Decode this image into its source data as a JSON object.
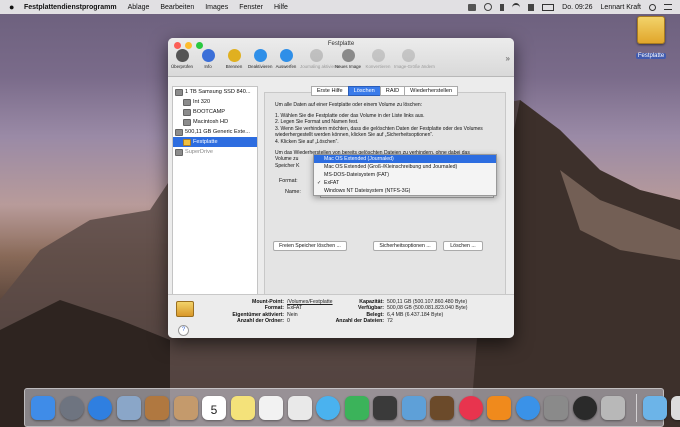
{
  "menubar": {
    "app_name": "Festplattendienstprogramm",
    "menus": [
      "Ablage",
      "Bearbeiten",
      "Images",
      "Fenster",
      "Hilfe"
    ],
    "clock": "Do. 09:26",
    "user": "Lennart Kraft"
  },
  "desktop": {
    "drive_label": "Festplatte"
  },
  "window": {
    "title": "Festplatte",
    "toolbar": [
      {
        "label": "Überprüfen",
        "icon": "microscope-icon",
        "color": "#555555",
        "enabled": true
      },
      {
        "label": "Info",
        "icon": "info-icon",
        "color": "#3b6fd8",
        "enabled": true
      },
      {
        "label": "Brennen",
        "icon": "burn-icon",
        "color": "#e0b020",
        "enabled": true
      },
      {
        "label": "Deaktivieren",
        "icon": "eject-icon",
        "color": "#2f8fe8",
        "enabled": true
      },
      {
        "label": "Auswerfen",
        "icon": "eject-icon",
        "color": "#2f8fe8",
        "enabled": true
      },
      {
        "label": "Journaling aktivieren",
        "icon": "journal-icon",
        "color": "#7a7a7a",
        "enabled": false
      },
      {
        "label": "Neues Image",
        "icon": "new-image-icon",
        "color": "#8a8a8a",
        "enabled": true
      },
      {
        "label": "Konvertieren",
        "icon": "convert-icon",
        "color": "#8a8a8a",
        "enabled": false
      },
      {
        "label": "Image-Größe ändern",
        "icon": "resize-icon",
        "color": "#8a8a8a",
        "enabled": false
      }
    ],
    "more": "»"
  },
  "sidebar": {
    "items": [
      {
        "label": "1 TB Samsung SSD 840...",
        "indent": 0,
        "selected": false,
        "dim": false
      },
      {
        "label": "Int 320",
        "indent": 1,
        "selected": false,
        "dim": false
      },
      {
        "label": "BOOTCAMP",
        "indent": 1,
        "selected": false,
        "dim": false
      },
      {
        "label": "Macintosh HD",
        "indent": 1,
        "selected": false,
        "dim": false
      },
      {
        "label": "500,11 GB Generic Exte...",
        "indent": 0,
        "selected": false,
        "dim": false
      },
      {
        "label": "Festplatte",
        "indent": 1,
        "selected": true,
        "dim": false
      },
      {
        "label": "SuperDrive",
        "indent": 0,
        "selected": false,
        "dim": true
      }
    ]
  },
  "tabs": [
    "Erste Hilfe",
    "Löschen",
    "RAID",
    "Wiederherstellen"
  ],
  "active_tab": "Löschen",
  "instructions": {
    "intro": "Um alle Daten auf einer Festplatte oder einem Volume zu löschen:",
    "steps": [
      "1.   Wählen Sie die Festplatte oder das Volume in der Liste links aus.",
      "2.   Legen Sie Format und Namen fest.",
      "3.   Wenn Sie verhindern möchten, dass die gelöschten Daten der Festplatte oder des Volumes wiederhergestellt werden können, klicken Sie auf „Sicherheitsoptionen“.",
      "4.   Klicken Sie auf „Löschen“."
    ],
    "recovery_l1": "Um das Wiederherstellen von bereits gelöschten Dateien zu verhindern, ohne dabei das",
    "recovery_l2": "Volume zu",
    "recovery_l3": "Speicher K"
  },
  "format_label": "Format:",
  "name_label": "Name:",
  "format_options": [
    {
      "label": "Mac OS Extended (Journaled)",
      "highlighted": true,
      "checked": false
    },
    {
      "label": "Mac OS Extended (Groß-/Kleinschreibung und Journaled)",
      "highlighted": false,
      "checked": false
    },
    {
      "label": "MS-DOS-Dateisystem (FAT)",
      "highlighted": false,
      "checked": false
    },
    {
      "label": "ExFAT",
      "highlighted": false,
      "checked": true
    },
    {
      "label": "Windows NT Dateisystem (NTFS-3G)",
      "highlighted": false,
      "checked": false
    }
  ],
  "buttons": {
    "free_space": "Freien Speicher löschen ...",
    "security": "Sicherheitsoptionen ...",
    "erase": "Löschen ..."
  },
  "info": {
    "mount_point_label": "Mount-Point:",
    "mount_point": "/Volumes/Festplatte",
    "format_label": "Format:",
    "format": "ExFAT",
    "owners_label": "Eigentümer aktiviert:",
    "owners": "Nein",
    "folders_label": "Anzahl der Ordner:",
    "folders": "0",
    "capacity_label": "Kapazität:",
    "capacity": "500,11 GB (500.107.860.480 Byte)",
    "available_label": "Verfügbar:",
    "available": "500,08 GB (500.081.823.040 Byte)",
    "used_label": "Belegt:",
    "used": "6,4 MB (6.437.184 Byte)",
    "files_label": "Anzahl der Dateien:",
    "files": "72"
  },
  "dock": {
    "calendar_day": "5",
    "icons": [
      {
        "name": "finder-icon",
        "color": "#3f8ce8",
        "round": false
      },
      {
        "name": "launchpad-icon",
        "color": "#6e7480",
        "round": true
      },
      {
        "name": "safari-icon",
        "color": "#2f7fe0",
        "round": true
      },
      {
        "name": "preview-icon",
        "color": "#8aa6c8",
        "round": false
      },
      {
        "name": "notes-book-icon",
        "color": "#b07840",
        "round": false
      },
      {
        "name": "contacts-icon",
        "color": "#c49a6c",
        "round": false
      },
      {
        "name": "calendar-icon",
        "color": "#ffffff",
        "round": false
      },
      {
        "name": "notes-icon",
        "color": "#f4e27a",
        "round": false
      },
      {
        "name": "reminders-icon",
        "color": "#f2f2f2",
        "round": false
      },
      {
        "name": "photos-icon",
        "color": "#e9e9e9",
        "round": false
      },
      {
        "name": "messages-icon",
        "color": "#4ab2ef",
        "round": true
      },
      {
        "name": "facetime-icon",
        "color": "#3bb35a",
        "round": false
      },
      {
        "name": "photo-booth-icon",
        "color": "#3a3a3a",
        "round": false
      },
      {
        "name": "iphoto-icon",
        "color": "#5ea0d8",
        "round": false
      },
      {
        "name": "keynote-icon",
        "color": "#6b4a2a",
        "round": false
      },
      {
        "name": "itunes-icon",
        "color": "#e8344e",
        "round": true
      },
      {
        "name": "ibooks-icon",
        "color": "#f08a1c",
        "round": false
      },
      {
        "name": "app-store-icon",
        "color": "#3a92e8",
        "round": true
      },
      {
        "name": "system-preferences-icon",
        "color": "#8a8a8a",
        "round": false
      },
      {
        "name": "quicktime-icon",
        "color": "#2a2a2a",
        "round": true
      },
      {
        "name": "disk-utility-icon",
        "color": "#b8b8b8",
        "round": false
      }
    ],
    "right_icons": [
      {
        "name": "downloads-folder-icon",
        "color": "#6cb4e8",
        "round": false
      },
      {
        "name": "trash-icon",
        "color": "#dcdcdc",
        "round": false
      }
    ]
  }
}
